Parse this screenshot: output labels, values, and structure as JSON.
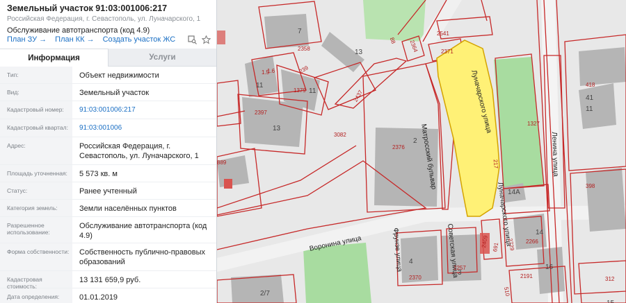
{
  "header": {
    "title": "Земельный участок 91:03:001006:217",
    "address": "Российская Федерация, г. Севастополь, ул. Луначарского, 1",
    "usage": "Обслуживание автотранспорта (код 4.9)"
  },
  "links": [
    {
      "label": "План ЗУ"
    },
    {
      "label": "План КК"
    },
    {
      "label": "Создать участок ЖС"
    }
  ],
  "icons": {
    "search_map": "map-search-icon",
    "favorite": "star-icon"
  },
  "tabs": [
    {
      "label": "Информация",
      "active": true
    },
    {
      "label": "Услуги",
      "active": false
    }
  ],
  "info": [
    {
      "key": "Тип:",
      "value": "Объект недвижимости"
    },
    {
      "key": "Вид:",
      "value": "Земельный участок"
    },
    {
      "key": "Кадастровый номер:",
      "value": "91:03:001006:217",
      "link": true
    },
    {
      "key": "Кадастровый квартал:",
      "value": "91:03:001006",
      "link": true
    },
    {
      "key": "Адрес:",
      "value": "Российская Федерация, г. Севастополь, ул. Луначарского, 1"
    },
    {
      "key": "Площадь уточненная:",
      "value": "5 573 кв. м"
    },
    {
      "key": "Статус:",
      "value": "Ранее учтенный"
    },
    {
      "key": "Категория земель:",
      "value": "Земли населённых пунктов"
    },
    {
      "key": "Разрешенное использование:",
      "value": "Обслуживание автотранспорта (код 4.9)"
    },
    {
      "key": "Форма собственности:",
      "value": "Собственность публично-правовых образований"
    },
    {
      "key": "Кадастровая стоимость:",
      "value": "13 131 659,9 руб."
    },
    {
      "key": "Дата определения:",
      "value": "01.01.2019"
    }
  ],
  "map": {
    "streets": [
      {
        "name": "Матросский бульвар"
      },
      {
        "name": "Луначарского улица"
      },
      {
        "name": "Ленина улица"
      },
      {
        "name": "Воронина улица"
      },
      {
        "name": "Фрунзе улица"
      },
      {
        "name": "Советская улица"
      },
      {
        "name": "Луначарского улица"
      }
    ],
    "building_numbers": [
      "7",
      "13",
      "11",
      "11",
      "13",
      "2",
      "14А",
      "11",
      "41",
      "4",
      "3",
      "16",
      "2/7",
      "14",
      "15"
    ],
    "parcel_numbers": [
      "2358",
      "2364",
      "2541",
      "2371",
      "1379",
      "2397",
      "2437",
      "3082",
      "2376",
      "1327",
      "398",
      "889",
      "2266",
      "2729",
      "2257",
      "2370",
      "2191",
      "312",
      "217",
      "418",
      "1.6",
      "239",
      "88",
      "2409",
      "691",
      "510",
      "1.5"
    ],
    "colors": {
      "selected_parcel": "#fff176",
      "boundary": "#c62828",
      "green": "#a8dca0",
      "building": "#b5b5b5"
    }
  }
}
